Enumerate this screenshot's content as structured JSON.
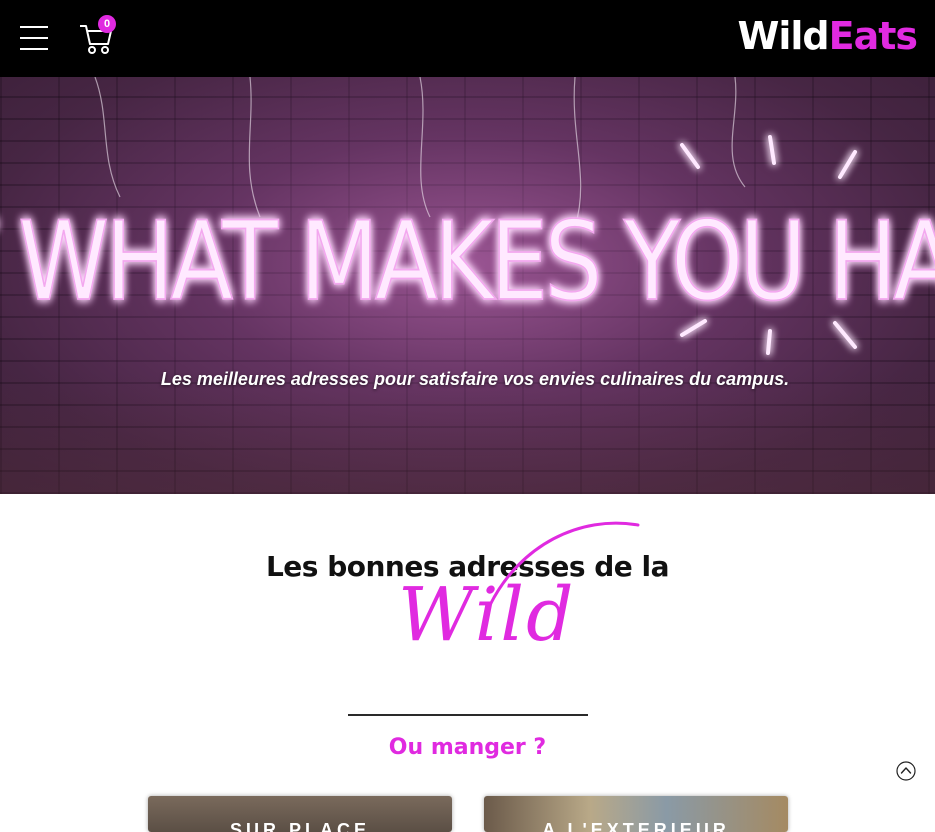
{
  "header": {
    "cart_count": "0",
    "logo_part1": "Wild",
    "logo_part2": "Eats"
  },
  "hero": {
    "neon_text": "EAT WHAT MAKES YOU HAPPY",
    "tagline": "Les meilleures adresses pour satisfaire vos envies culinaires du campus."
  },
  "section": {
    "title": "Les bonnes adresses de la",
    "script_word": "Wild",
    "subtitle": "Ou manger ?"
  },
  "cards": [
    {
      "label": "SUR PLACE"
    },
    {
      "label": "A L'EXTERIEUR"
    }
  ],
  "icons": {
    "menu": "hamburger-icon",
    "cart": "shopping-cart-icon",
    "scroll_top": "chevron-up-circle-icon"
  },
  "colors": {
    "accent": "#e02ae0",
    "header_bg": "#000000"
  }
}
